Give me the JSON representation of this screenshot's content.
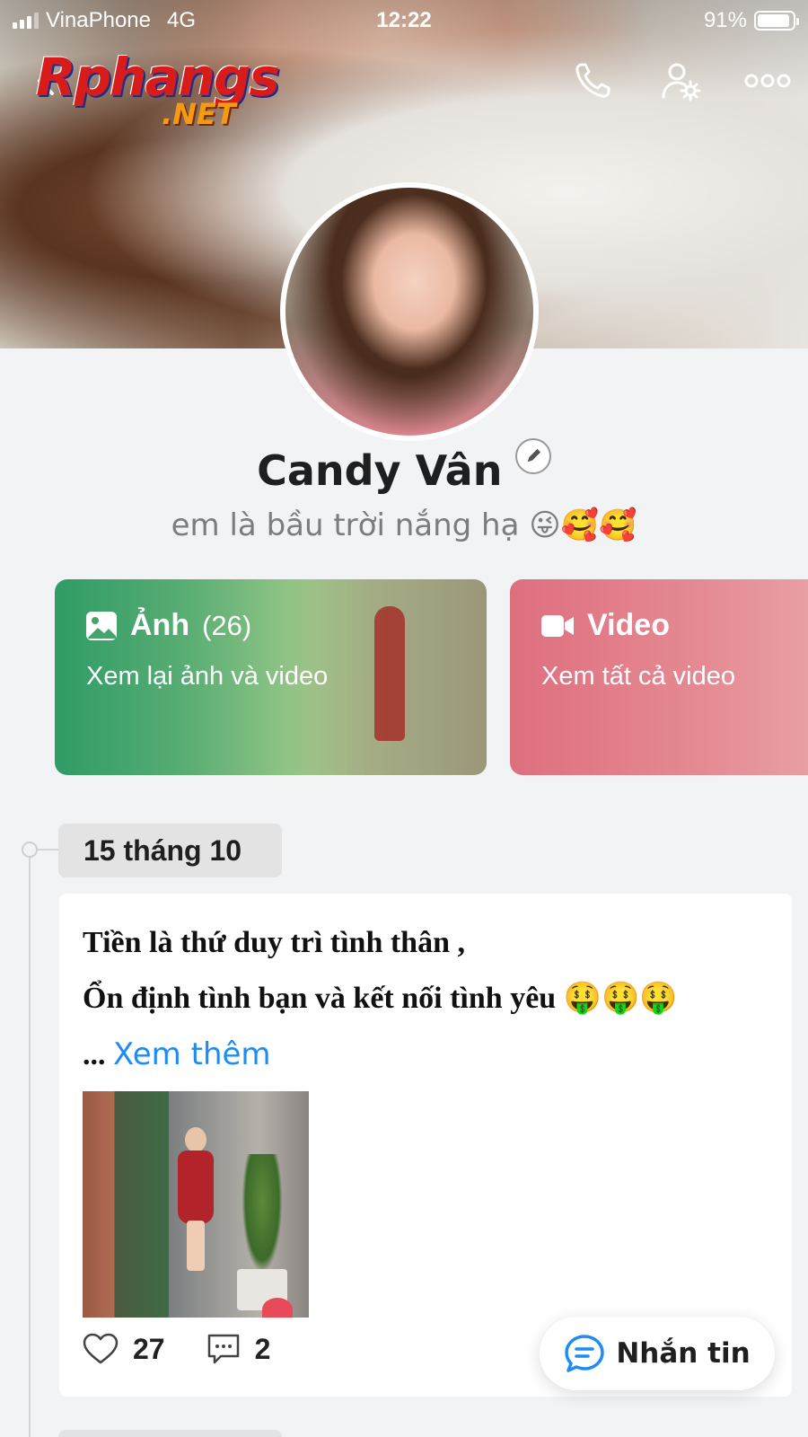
{
  "status_bar": {
    "carrier": "VinaPhone",
    "network": "4G",
    "time": "12:22",
    "battery": "91%",
    "battery_level": 0.91
  },
  "watermark": {
    "line1": "Rphangs",
    "line2": ".NET"
  },
  "header_icons": [
    "back-icon",
    "phone-icon",
    "user-settings-icon",
    "more-icon"
  ],
  "profile": {
    "name": "Candy Vân",
    "bio": "em là bầu trời nắng hạ 😜🥰🥰"
  },
  "media": {
    "photos_title": "Ảnh",
    "photos_count": "(26)",
    "photos_sub": "Xem lại ảnh và video",
    "video_title": "Video",
    "video_sub": "Xem tất cả video"
  },
  "timeline": {
    "date": "15 tháng 10"
  },
  "post": {
    "line1": "Tiền là thứ duy trì tình thân ,",
    "line2": "Ổn định tình bạn và kết nối tình yêu 🤑🤑🤑",
    "ellipsis": "... ",
    "see_more": "Xem thêm",
    "likes": "27",
    "comments": "2"
  },
  "message_button": {
    "label": "Nhắn tin"
  },
  "colors": {
    "link": "#1e8cf0",
    "photos_card": "#2f9b66",
    "video_card": "#de6f7e",
    "background": "#f2f3f5"
  }
}
